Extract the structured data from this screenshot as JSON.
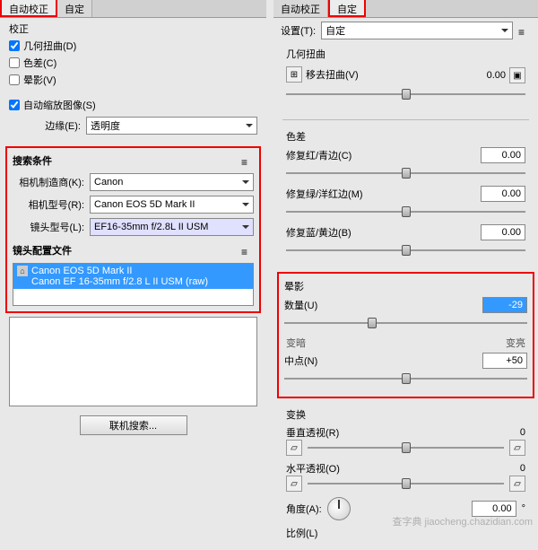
{
  "left": {
    "tabs": {
      "auto": "自动校正",
      "custom": "自定"
    },
    "correction_title": "校正",
    "chk_geom": "几何扭曲(D)",
    "chk_chroma": "色差(C)",
    "chk_vignette": "晕影(V)",
    "chk_autoscale": "自动缩放图像(S)",
    "edge_label": "边缘(E):",
    "edge_value": "透明度",
    "search": {
      "title": "搜索条件",
      "maker_label": "相机制造商(K):",
      "maker_value": "Canon",
      "model_label": "相机型号(R):",
      "model_value": "Canon EOS 5D Mark II",
      "lens_label": "镜头型号(L):",
      "lens_value": "EF16-35mm f/2.8L II USM"
    },
    "profile_title": "镜头配置文件",
    "profile_line1": "Canon EOS 5D Mark II",
    "profile_line2": "Canon EF 16-35mm f/2.8 L II USM (raw)",
    "search_online_btn": "联机搜索..."
  },
  "right": {
    "tabs": {
      "auto": "自动校正",
      "custom": "自定"
    },
    "settings_label": "设置(T):",
    "settings_value": "自定",
    "geom": {
      "title": "几何扭曲",
      "remove_label": "移去扭曲(V)",
      "remove_value": "0.00"
    },
    "chroma": {
      "title": "色差",
      "rc_label": "修复红/青边(C)",
      "rc_value": "0.00",
      "gm_label": "修复绿/洋红边(M)",
      "gm_value": "0.00",
      "by_label": "修复蓝/黄边(B)",
      "by_value": "0.00"
    },
    "vignette": {
      "title": "晕影",
      "amount_label": "数量(U)",
      "amount_value": "-29",
      "darker": "变暗",
      "lighter": "变亮",
      "midpoint_label": "中点(N)",
      "midpoint_value": "+50"
    },
    "transform": {
      "title": "变换",
      "vpersp_label": "垂直透视(R)",
      "vpersp_value": "0",
      "hpersp_label": "水平透视(O)",
      "hpersp_value": "0",
      "angle_label": "角度(A):",
      "angle_value": "0.00",
      "scale_label": "比例(L)"
    }
  },
  "watermark": "查字典   jiaocheng.chazidian.com"
}
